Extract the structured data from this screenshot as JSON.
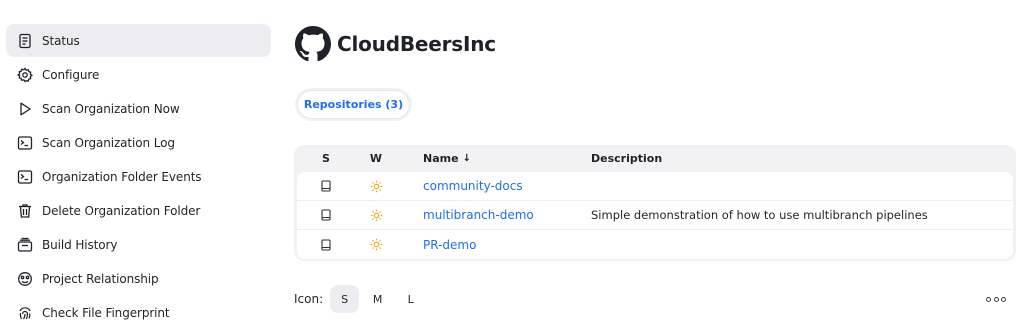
{
  "sidebar": {
    "items": [
      {
        "label": "Status",
        "icon": "status-icon"
      },
      {
        "label": "Configure",
        "icon": "gear-icon"
      },
      {
        "label": "Scan Organization Now",
        "icon": "play-icon"
      },
      {
        "label": "Scan Organization Log",
        "icon": "terminal-icon"
      },
      {
        "label": "Organization Folder Events",
        "icon": "terminal-icon"
      },
      {
        "label": "Delete Organization Folder",
        "icon": "trash-icon"
      },
      {
        "label": "Build History",
        "icon": "build-history-icon"
      },
      {
        "label": "Project Relationship",
        "icon": "relationship-icon"
      },
      {
        "label": "Check File Fingerprint",
        "icon": "fingerprint-icon"
      }
    ]
  },
  "header": {
    "title": "CloudBeersInc",
    "icon": "github-icon"
  },
  "tabs": [
    {
      "label": "Repositories (3)"
    }
  ],
  "table": {
    "columns": {
      "s": "S",
      "w": "W",
      "name": "Name",
      "name_sort": "↓",
      "description": "Description"
    },
    "rows": [
      {
        "name": "community-docs",
        "description": ""
      },
      {
        "name": "multibranch-demo",
        "description": "Simple demonstration of how to use multibranch pipelines"
      },
      {
        "name": "PR-demo",
        "description": ""
      }
    ]
  },
  "icon_size": {
    "label": "Icon:",
    "options": [
      "S",
      "M",
      "L"
    ],
    "selected": "S"
  },
  "colors": {
    "link": "#1f6feb",
    "active_bg": "#ececf1",
    "sun": "#f0a400"
  }
}
